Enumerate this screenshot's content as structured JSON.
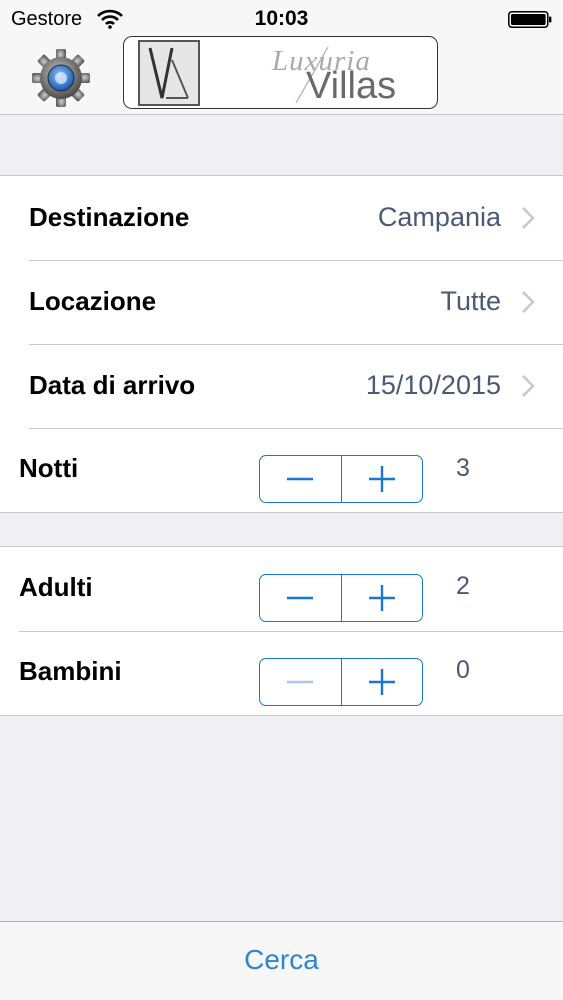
{
  "status_bar": {
    "carrier": "Gestore",
    "time": "10:03"
  },
  "nav": {
    "logo_script": "Luxuria",
    "logo_word": "Villas",
    "gear_icon": "gear-icon"
  },
  "form": {
    "destination": {
      "label": "Destinazione",
      "value": "Campania"
    },
    "location": {
      "label": "Locazione",
      "value": "Tutte"
    },
    "arrival_date": {
      "label": "Data di arrivo",
      "value": "15/10/2015"
    },
    "nights": {
      "label": "Notti",
      "value": "3"
    },
    "adults": {
      "label": "Adulti",
      "value": "2"
    },
    "children": {
      "label": "Bambini",
      "value": "0"
    }
  },
  "toolbar": {
    "search_label": "Cerca"
  },
  "colors": {
    "accent": "#1976d2",
    "value_text": "#4a5a74",
    "link": "#2e86d0",
    "background": "#efeff4"
  }
}
